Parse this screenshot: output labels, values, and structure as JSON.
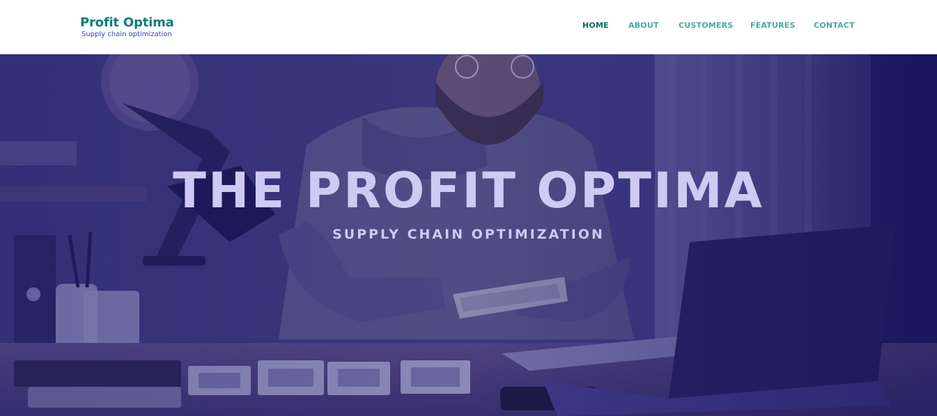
{
  "header": {
    "brand_name": "Profit Optima",
    "brand_tagline": "Supply chain optimization",
    "nav": [
      {
        "label": "HOME",
        "active": true
      },
      {
        "label": "ABOUT",
        "active": false
      },
      {
        "label": "CUSTOMERS",
        "active": false
      },
      {
        "label": "FEATURES",
        "active": false
      },
      {
        "label": "CONTACT",
        "active": false
      }
    ]
  },
  "hero": {
    "title": "THE PROFIT OPTIMA",
    "subtitle": "SUPPLY CHAIN OPTIMIZATION",
    "overlay_color": "#2a237a"
  },
  "colors": {
    "brand": "#0f7d76",
    "tagline": "#3a3fbf",
    "nav": "#4aaa9e",
    "nav_active": "#0a6b63",
    "hero_text": "#cfcaf3"
  }
}
